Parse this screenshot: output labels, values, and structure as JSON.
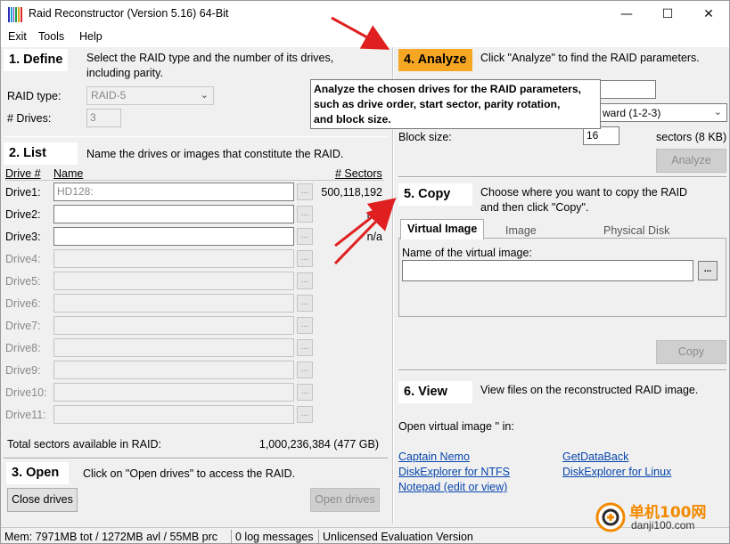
{
  "window": {
    "title": "Raid Reconstructor (Version 5.16) 64-Bit",
    "controls": {
      "minimize": "—",
      "maximize": "☐",
      "close": "✕"
    },
    "icon_colors": [
      "#2b2bb5",
      "#1aa4d8",
      "#7b2bb5",
      "#1a9e4b",
      "#d8a21a",
      "#d82b2b"
    ]
  },
  "menu": [
    "Exit",
    "Tools",
    "Help"
  ],
  "define": {
    "step": "1. Define",
    "desc_line1": "Select the RAID type and the number of its drives,",
    "desc_line2": "including parity.",
    "raid_type_label": "RAID type:",
    "raid_type_value": "RAID-5",
    "drives_label": "# Drives:",
    "drives_value": "3"
  },
  "list": {
    "step": "2. List",
    "desc": "Name the drives or images that constitute the RAID.",
    "col_drive": "Drive #",
    "col_name": "Name",
    "col_sectors": "# Sectors",
    "drives": [
      {
        "label": "Drive1:",
        "value": "HD128:",
        "sectors": "500,118,192",
        "enabled": true
      },
      {
        "label": "Drive2:",
        "value": "",
        "sectors": "n/a",
        "enabled": true
      },
      {
        "label": "Drive3:",
        "value": "",
        "sectors": "n/a",
        "enabled": true
      },
      {
        "label": "Drive4:",
        "value": "",
        "sectors": "",
        "enabled": false
      },
      {
        "label": "Drive5:",
        "value": "",
        "sectors": "",
        "enabled": false
      },
      {
        "label": "Drive6:",
        "value": "",
        "sectors": "",
        "enabled": false
      },
      {
        "label": "Drive7:",
        "value": "",
        "sectors": "",
        "enabled": false
      },
      {
        "label": "Drive8:",
        "value": "",
        "sectors": "",
        "enabled": false
      },
      {
        "label": "Drive9:",
        "value": "",
        "sectors": "",
        "enabled": false
      },
      {
        "label": "Drive10:",
        "value": "",
        "sectors": "",
        "enabled": false
      },
      {
        "label": "Drive11:",
        "value": "",
        "sectors": "",
        "enabled": false
      }
    ],
    "browse_label": "...",
    "total_label": "Total sectors available in RAID:",
    "total_value": "1,000,236,384 (477 GB)"
  },
  "open": {
    "step": "3. Open",
    "desc": "Click on \"Open drives\" to access the RAID.",
    "close_button": "Close drives",
    "open_button": "Open drives"
  },
  "analyze": {
    "step": "4. Analyze",
    "desc": "Click \"Analyze\" to find the RAID parameters.",
    "rotation_value": "ward (1-2-3)",
    "block_size_label": "Block size:",
    "block_size_value": "16",
    "sectors_label": "sectors (8 KB)",
    "button": "Analyze",
    "tooltip": [
      "Analyze the chosen drives for the RAID parameters,",
      "such as drive order, start sector, parity rotation,",
      "and block size."
    ]
  },
  "copy": {
    "step": "5. Copy",
    "desc_line1": "Choose where you want to copy the RAID",
    "desc_line2": "and then click \"Copy\".",
    "tabs": [
      "Virtual Image",
      "Image",
      "Physical Disk"
    ],
    "virtual_image_label": "Name of the virtual image:",
    "browse_label": "...",
    "button": "Copy"
  },
  "view": {
    "step": "6. View",
    "desc": "View files on the reconstructed RAID image.",
    "open_in": "Open virtual image '' in:",
    "links": {
      "captain_nemo": "Captain Nemo",
      "getdataback": "GetDataBack",
      "de_ntfs": "DiskExplorer for NTFS",
      "de_linux": "DiskExplorer for Linux",
      "notepad": "Notepad (edit or view)"
    }
  },
  "status": {
    "mem": "Mem: 7971MB tot / 1272MB avl / 55MB prc",
    "log": "0 log messages",
    "license": "Unlicensed Evaluation Version"
  },
  "watermark": {
    "cn": "单机100网",
    "url": "danji100.com"
  },
  "colors": {
    "analyze_step": "#f5a623",
    "arrow": "#e02020",
    "link": "#0645ad"
  }
}
